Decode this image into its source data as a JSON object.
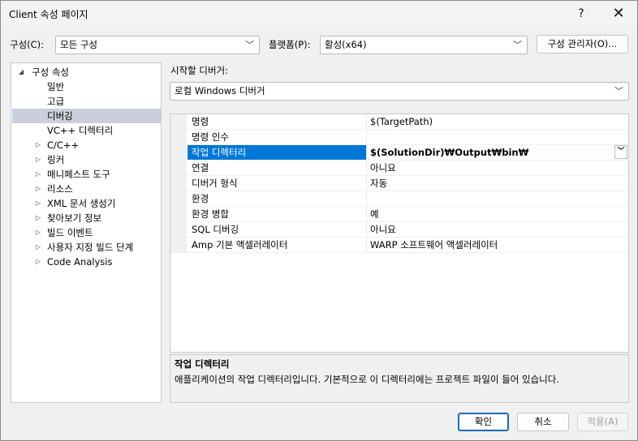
{
  "window": {
    "title": "Client 속성 페이지",
    "help_label": "?",
    "close_label": "✕"
  },
  "toolbar": {
    "config_label": "구성(C):",
    "config_value": "모든 구성",
    "platform_label": "플랫폼(P):",
    "platform_value": "활성(x64)",
    "config_manager_label": "구성 관리자(O)..."
  },
  "tree": {
    "items": [
      {
        "label": "구성 속성",
        "arrow": "◢",
        "level": 0
      },
      {
        "label": "일반",
        "arrow": "",
        "level": 2
      },
      {
        "label": "고급",
        "arrow": "",
        "level": 2
      },
      {
        "label": "디버깅",
        "arrow": "",
        "level": 2,
        "selected": true
      },
      {
        "label": "VC++ 디렉터리",
        "arrow": "",
        "level": 2
      },
      {
        "label": "C/C++",
        "arrow": "▷",
        "level": 1
      },
      {
        "label": "링커",
        "arrow": "▷",
        "level": 1
      },
      {
        "label": "매니페스트 도구",
        "arrow": "▷",
        "level": 1
      },
      {
        "label": "리소스",
        "arrow": "▷",
        "level": 1
      },
      {
        "label": "XML 문서 생성기",
        "arrow": "▷",
        "level": 1
      },
      {
        "label": "찾아보기 정보",
        "arrow": "▷",
        "level": 1
      },
      {
        "label": "빌드 이벤트",
        "arrow": "▷",
        "level": 1
      },
      {
        "label": "사용자 지정 빌드 단계",
        "arrow": "▷",
        "level": 1
      },
      {
        "label": "Code Analysis",
        "arrow": "▷",
        "level": 1
      }
    ]
  },
  "debugger": {
    "label": "시작할 디버거:",
    "value": "로컬 Windows 디버거"
  },
  "properties": [
    {
      "name": "명령",
      "value": "$(TargetPath)"
    },
    {
      "name": "명령 인수",
      "value": ""
    },
    {
      "name": "작업 디렉터리",
      "value": "$(SolutionDir)₩Output₩bin₩",
      "selected": true
    },
    {
      "name": "연결",
      "value": "아니요"
    },
    {
      "name": "디버거 형식",
      "value": "자동"
    },
    {
      "name": "환경",
      "value": ""
    },
    {
      "name": "환경 병합",
      "value": "예"
    },
    {
      "name": "SQL 디버깅",
      "value": "아니요"
    },
    {
      "name": "Amp 기본 액셀러레이터",
      "value": "WARP 소프트웨어 액셀러레이터"
    }
  ],
  "description": {
    "title": "작업 디렉터리",
    "text": "애플리케이션의 작업 디렉터리입니다. 기본적으로 이 디렉터리에는 프로젝트 파일이 들어 있습니다."
  },
  "buttons": {
    "ok": "확인",
    "cancel": "취소",
    "apply": "적용(A)"
  },
  "icons": {
    "dropdown": "chevron-down-icon",
    "expand": "triangle-right-icon",
    "expanded": "triangle-down-icon"
  }
}
